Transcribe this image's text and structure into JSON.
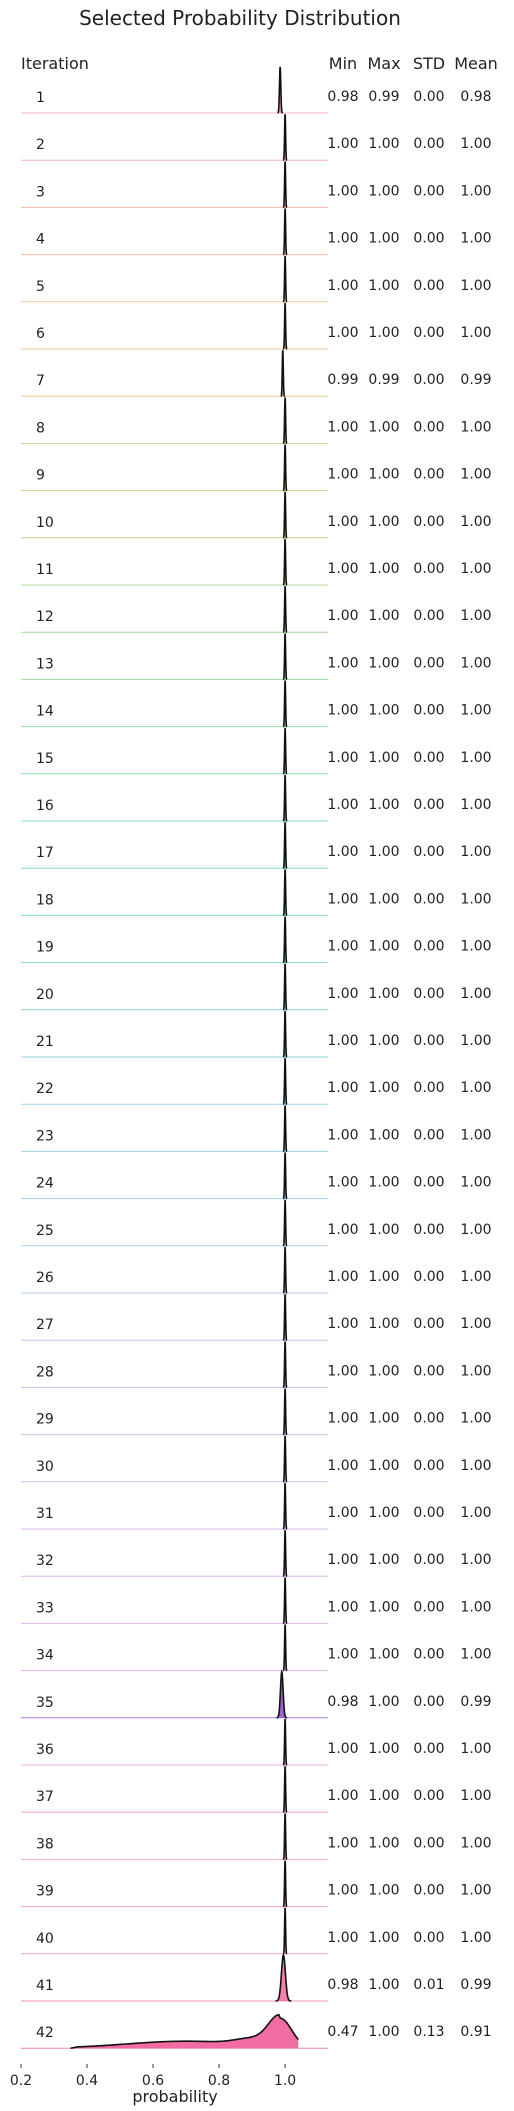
{
  "chart_data": {
    "type": "ridgeline",
    "title": "Selected Probability Distribution",
    "xlabel": "probability",
    "row_header": "Iteration",
    "stat_headers": [
      "Min",
      "Max",
      "STD",
      "Mean"
    ],
    "xlim": [
      0.2,
      1.13
    ],
    "xticks": [
      "0.2",
      "0.4",
      "0.6",
      "0.8",
      "1.0"
    ],
    "tick_values": [
      0.2,
      0.4,
      0.6,
      0.8,
      1.0
    ],
    "rows": [
      {
        "iteration": "1",
        "min": "0.98",
        "max": "0.99",
        "std": "0.00",
        "mean": "0.98",
        "center": 0.985,
        "spread": 0.002,
        "color": "#f4a0b4"
      },
      {
        "iteration": "2",
        "min": "1.00",
        "max": "1.00",
        "std": "0.00",
        "mean": "1.00",
        "center": 1.0,
        "spread": 0.001,
        "color": "#f5a2a8"
      },
      {
        "iteration": "3",
        "min": "1.00",
        "max": "1.00",
        "std": "0.00",
        "mean": "1.00",
        "center": 1.0,
        "spread": 0.001,
        "color": "#f4a69c"
      },
      {
        "iteration": "4",
        "min": "1.00",
        "max": "1.00",
        "std": "0.00",
        "mean": "1.00",
        "center": 1.0,
        "spread": 0.001,
        "color": "#f1aa90"
      },
      {
        "iteration": "5",
        "min": "1.00",
        "max": "1.00",
        "std": "0.00",
        "mean": "1.00",
        "center": 1.0,
        "spread": 0.001,
        "color": "#ecb087"
      },
      {
        "iteration": "6",
        "min": "1.00",
        "max": "1.00",
        "std": "0.00",
        "mean": "1.00",
        "center": 1.0,
        "spread": 0.001,
        "color": "#e3b680"
      },
      {
        "iteration": "7",
        "min": "0.99",
        "max": "0.99",
        "std": "0.00",
        "mean": "0.99",
        "center": 0.993,
        "spread": 0.001,
        "color": "#d8bc7c"
      },
      {
        "iteration": "8",
        "min": "1.00",
        "max": "1.00",
        "std": "0.00",
        "mean": "1.00",
        "center": 1.0,
        "spread": 0.001,
        "color": "#ccc17a"
      },
      {
        "iteration": "9",
        "min": "1.00",
        "max": "1.00",
        "std": "0.00",
        "mean": "1.00",
        "center": 1.0,
        "spread": 0.001,
        "color": "#bec57a"
      },
      {
        "iteration": "10",
        "min": "1.00",
        "max": "1.00",
        "std": "0.00",
        "mean": "1.00",
        "center": 1.0,
        "spread": 0.001,
        "color": "#b0c87c"
      },
      {
        "iteration": "11",
        "min": "1.00",
        "max": "1.00",
        "std": "0.00",
        "mean": "1.00",
        "center": 1.0,
        "spread": 0.001,
        "color": "#a2cb80"
      },
      {
        "iteration": "12",
        "min": "1.00",
        "max": "1.00",
        "std": "0.00",
        "mean": "1.00",
        "center": 1.0,
        "spread": 0.001,
        "color": "#94cd86"
      },
      {
        "iteration": "13",
        "min": "1.00",
        "max": "1.00",
        "std": "0.00",
        "mean": "1.00",
        "center": 1.0,
        "spread": 0.001,
        "color": "#86ce8e"
      },
      {
        "iteration": "14",
        "min": "1.00",
        "max": "1.00",
        "std": "0.00",
        "mean": "1.00",
        "center": 1.0,
        "spread": 0.001,
        "color": "#7acf98"
      },
      {
        "iteration": "15",
        "min": "1.00",
        "max": "1.00",
        "std": "0.00",
        "mean": "1.00",
        "center": 1.0,
        "spread": 0.001,
        "color": "#70cfa2"
      },
      {
        "iteration": "16",
        "min": "1.00",
        "max": "1.00",
        "std": "0.00",
        "mean": "1.00",
        "center": 1.0,
        "spread": 0.001,
        "color": "#69cfac"
      },
      {
        "iteration": "17",
        "min": "1.00",
        "max": "1.00",
        "std": "0.00",
        "mean": "1.00",
        "center": 1.0,
        "spread": 0.001,
        "color": "#66cfb5"
      },
      {
        "iteration": "18",
        "min": "1.00",
        "max": "1.00",
        "std": "0.00",
        "mean": "1.00",
        "center": 1.0,
        "spread": 0.001,
        "color": "#66cebe"
      },
      {
        "iteration": "19",
        "min": "1.00",
        "max": "1.00",
        "std": "0.00",
        "mean": "1.00",
        "center": 1.0,
        "spread": 0.001,
        "color": "#69cdc6"
      },
      {
        "iteration": "20",
        "min": "1.00",
        "max": "1.00",
        "std": "0.00",
        "mean": "1.00",
        "center": 1.0,
        "spread": 0.001,
        "color": "#6ecccd"
      },
      {
        "iteration": "21",
        "min": "1.00",
        "max": "1.00",
        "std": "0.00",
        "mean": "1.00",
        "center": 1.0,
        "spread": 0.001,
        "color": "#75cad4"
      },
      {
        "iteration": "22",
        "min": "1.00",
        "max": "1.00",
        "std": "0.00",
        "mean": "1.00",
        "center": 1.0,
        "spread": 0.001,
        "color": "#7dc8da"
      },
      {
        "iteration": "23",
        "min": "1.00",
        "max": "1.00",
        "std": "0.00",
        "mean": "1.00",
        "center": 1.0,
        "spread": 0.001,
        "color": "#86c5df"
      },
      {
        "iteration": "24",
        "min": "1.00",
        "max": "1.00",
        "std": "0.00",
        "mean": "1.00",
        "center": 1.0,
        "spread": 0.001,
        "color": "#8fc2e3"
      },
      {
        "iteration": "25",
        "min": "1.00",
        "max": "1.00",
        "std": "0.00",
        "mean": "1.00",
        "center": 1.0,
        "spread": 0.001,
        "color": "#98bfe6"
      },
      {
        "iteration": "26",
        "min": "1.00",
        "max": "1.00",
        "std": "0.00",
        "mean": "1.00",
        "center": 1.0,
        "spread": 0.001,
        "color": "#a1bbe8"
      },
      {
        "iteration": "27",
        "min": "1.00",
        "max": "1.00",
        "std": "0.00",
        "mean": "1.00",
        "center": 1.0,
        "spread": 0.001,
        "color": "#aab7e9"
      },
      {
        "iteration": "28",
        "min": "1.00",
        "max": "1.00",
        "std": "0.00",
        "mean": "1.00",
        "center": 1.0,
        "spread": 0.001,
        "color": "#b3b3ea"
      },
      {
        "iteration": "29",
        "min": "1.00",
        "max": "1.00",
        "std": "0.00",
        "mean": "1.00",
        "center": 1.0,
        "spread": 0.001,
        "color": "#bbafe9"
      },
      {
        "iteration": "30",
        "min": "1.00",
        "max": "1.00",
        "std": "0.00",
        "mean": "1.00",
        "center": 1.0,
        "spread": 0.001,
        "color": "#c3abe8"
      },
      {
        "iteration": "31",
        "min": "1.00",
        "max": "1.00",
        "std": "0.00",
        "mean": "1.00",
        "center": 1.0,
        "spread": 0.001,
        "color": "#caa7e6"
      },
      {
        "iteration": "32",
        "min": "1.00",
        "max": "1.00",
        "std": "0.00",
        "mean": "1.00",
        "center": 1.0,
        "spread": 0.001,
        "color": "#d1a3e3"
      },
      {
        "iteration": "33",
        "min": "1.00",
        "max": "1.00",
        "std": "0.00",
        "mean": "1.00",
        "center": 1.0,
        "spread": 0.001,
        "color": "#d79fe0"
      },
      {
        "iteration": "34",
        "min": "1.00",
        "max": "1.00",
        "std": "0.00",
        "mean": "1.00",
        "center": 1.0,
        "spread": 0.001,
        "color": "#dc9cdc"
      },
      {
        "iteration": "35",
        "min": "0.98",
        "max": "1.00",
        "std": "0.00",
        "mean": "0.99",
        "center": 0.99,
        "spread": 0.004,
        "color": "#9b59d0"
      },
      {
        "iteration": "36",
        "min": "1.00",
        "max": "1.00",
        "std": "0.00",
        "mean": "1.00",
        "center": 1.0,
        "spread": 0.001,
        "color": "#e596cf"
      },
      {
        "iteration": "37",
        "min": "1.00",
        "max": "1.00",
        "std": "0.00",
        "mean": "1.00",
        "center": 1.0,
        "spread": 0.001,
        "color": "#e894c8"
      },
      {
        "iteration": "38",
        "min": "1.00",
        "max": "1.00",
        "std": "0.00",
        "mean": "1.00",
        "center": 1.0,
        "spread": 0.001,
        "color": "#eb93c0"
      },
      {
        "iteration": "39",
        "min": "1.00",
        "max": "1.00",
        "std": "0.00",
        "mean": "1.00",
        "center": 1.0,
        "spread": 0.001,
        "color": "#ed92b8"
      },
      {
        "iteration": "40",
        "min": "1.00",
        "max": "1.00",
        "std": "0.00",
        "mean": "1.00",
        "center": 1.0,
        "spread": 0.001,
        "color": "#ef92b0"
      },
      {
        "iteration": "41",
        "min": "0.98",
        "max": "1.00",
        "std": "0.01",
        "mean": "0.99",
        "center": 0.995,
        "spread": 0.006,
        "color": "#f07aa8"
      },
      {
        "iteration": "42",
        "min": "0.47",
        "max": "1.00",
        "std": "0.13",
        "mean": "0.91",
        "center": 0.99,
        "spread": 0.04,
        "color": "#f0649e"
      }
    ]
  }
}
